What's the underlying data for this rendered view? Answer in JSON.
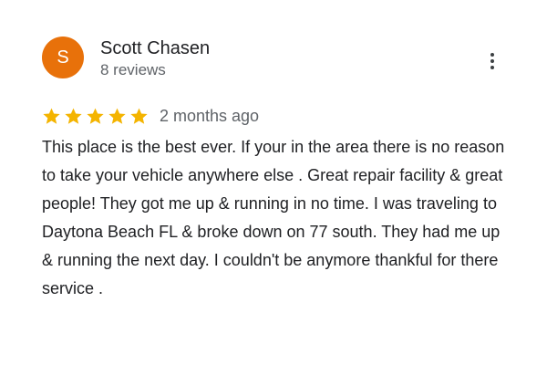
{
  "review": {
    "avatar_initial": "S",
    "avatar_color": "#E8710A",
    "reviewer_name": "Scott Chasen",
    "review_count": "8 reviews",
    "rating": 5,
    "rating_max": 5,
    "star_color": "#F4B400",
    "date": "2 months ago",
    "text": "This place is the best ever. If your in the area there is no reason to take your vehicle anywhere else . Great repair facility & great people! They got me up & running in no time. I was traveling to Daytona Beach FL & broke down on 77 south. They had me up & running the next day. I couldn't be anymore thankful for there service .",
    "more_icon": "more-vert-icon"
  }
}
